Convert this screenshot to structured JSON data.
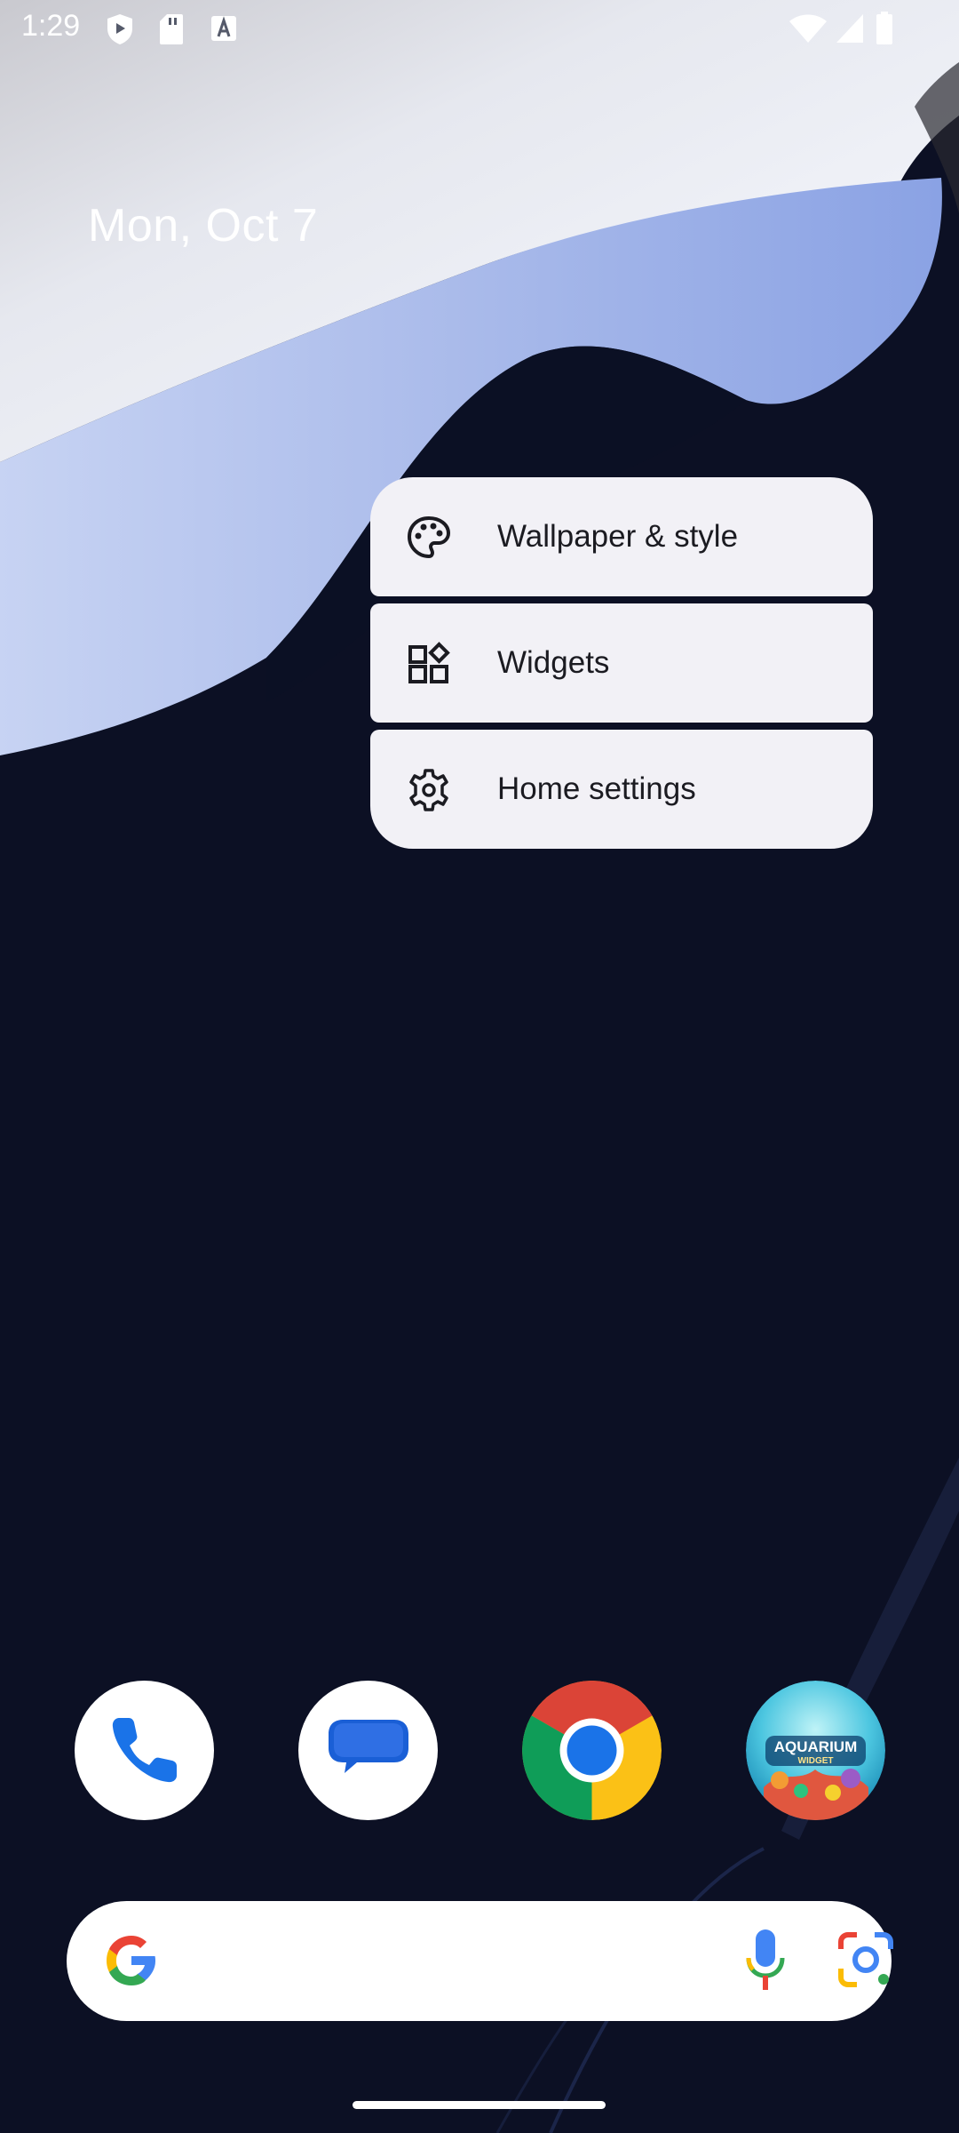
{
  "status_bar": {
    "time": "1:29",
    "icons": [
      "shield-play-icon",
      "sd-card-icon",
      "font-a-icon",
      "wifi-icon",
      "cellular-signal-icon",
      "battery-icon"
    ]
  },
  "home": {
    "date": "Mon, Oct 7"
  },
  "context_menu": {
    "items": [
      {
        "label": "Wallpaper & style",
        "icon": "palette-icon"
      },
      {
        "label": "Widgets",
        "icon": "widgets-icon"
      },
      {
        "label": "Home settings",
        "icon": "gear-icon"
      }
    ]
  },
  "dock": {
    "apps": [
      {
        "name": "Phone",
        "icon": "phone-icon"
      },
      {
        "name": "Messages",
        "icon": "messages-icon"
      },
      {
        "name": "Chrome",
        "icon": "chrome-icon"
      },
      {
        "name": "Aquarium Widget",
        "icon": "aquarium-widget-icon",
        "logo_text": "AQUARIUM WIDGET"
      }
    ]
  },
  "search_bar": {
    "icons": [
      "google-g-icon",
      "microphone-icon",
      "google-lens-icon"
    ]
  },
  "colors": {
    "menu_background": "#f2f1f6",
    "menu_text": "#1b1b21",
    "wallpaper_dark": "#0c1024",
    "wallpaper_light": "#e4e9f7",
    "wallpaper_blue": "#8aa2e4"
  }
}
